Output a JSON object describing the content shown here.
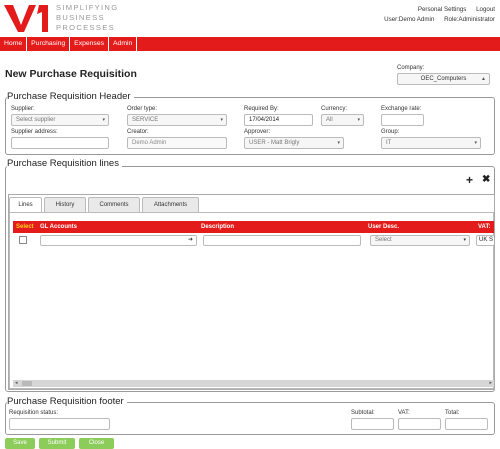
{
  "brand": {
    "line1": "SIMPLIFYING",
    "line2": "BUSINESS",
    "line3": "PROCESSES",
    "logo_color": "#e41b1b"
  },
  "top": {
    "personal_settings": "Personal Settings",
    "logout": "Logout",
    "user": "User:Demo Admin",
    "role": "Role:Administrator"
  },
  "nav": {
    "items": [
      "Home",
      "Purchasing",
      "Expenses",
      "Admin"
    ]
  },
  "page": {
    "title": "New Purchase Requisition"
  },
  "company": {
    "label": "Company:",
    "value": "OEC_Computers"
  },
  "header": {
    "title": "Purchase Requisition Header",
    "supplier_label": "Supplier:",
    "supplier_value": "Select supplier",
    "order_type_label": "Order type:",
    "order_type_value": "SERVICE",
    "required_by_label": "Required By:",
    "required_by_value": "17/04/2014",
    "currency_label": "Currency:",
    "currency_value": "All",
    "exchange_rate_label": "Exchange rate:",
    "exchange_rate_value": "",
    "supplier_address_label": "Supplier address:",
    "supplier_address_value": "",
    "creator_label": "Creator:",
    "creator_value": "Demo Admin",
    "approver_label": "Approver:",
    "approver_value": "USER - Matt Brigly",
    "group_label": "Group:",
    "group_value": "IT"
  },
  "lines": {
    "title": "Purchase Requisition lines",
    "add_icon": "+",
    "delete_icon": "✖",
    "tabs": [
      "Lines",
      "History",
      "Comments",
      "Attachments"
    ],
    "columns": {
      "select": "Select",
      "gl_accounts": "GL Accounts",
      "description": "Description",
      "user_desc": "User Desc.",
      "vat": "VAT:"
    },
    "row": {
      "gl": "",
      "description": "",
      "user_desc": "Select",
      "vat": "UK S"
    }
  },
  "footer": {
    "title": "Purchase Requisition footer",
    "status_label": "Requisition status:",
    "status_value": "",
    "subtotal_label": "Subtotal:",
    "vat_label": "VAT:",
    "total_label": "Total:"
  },
  "buttons": {
    "save": "Save",
    "submit": "Submit",
    "close": "Close"
  },
  "colors": {
    "accent": "#e41b1b",
    "button": "#8ccc5b"
  }
}
